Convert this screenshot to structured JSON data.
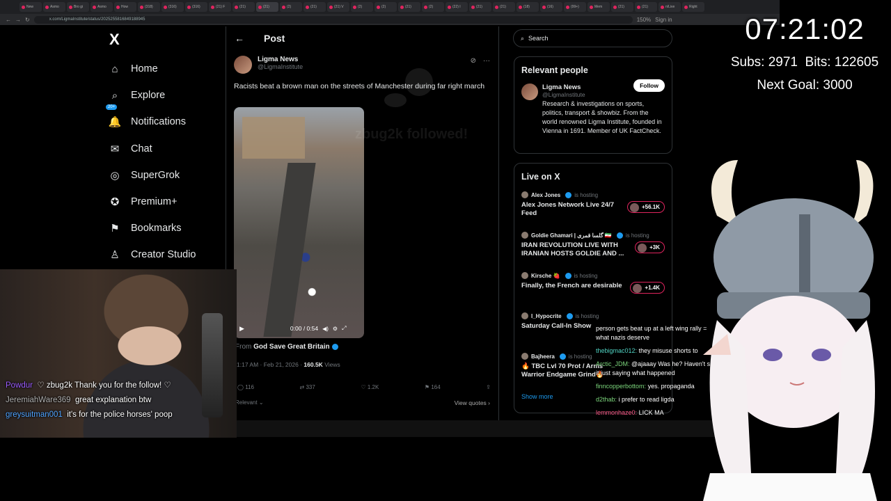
{
  "browser": {
    "tabs": [
      "New",
      "Asmo",
      "Bro gi",
      "Asmo",
      "How",
      "(318)",
      "(316)",
      "(316)",
      "(21) F",
      "(21)",
      "(21)",
      "(2)",
      "(21)",
      "(21) V",
      "(2)",
      "(2)",
      "(21)",
      "(2)",
      "(22) I",
      "(21)",
      "(21)",
      "(18)",
      "(16)",
      "(99+)",
      "Mem",
      "(21)",
      "(21)",
      "n/Live",
      "Right"
    ],
    "active_tab_index": 10,
    "url": "x.com/LigmaInstitute/status/2025255816849188945",
    "zoom": "150%",
    "sign_in": "Sign in"
  },
  "sidebar": {
    "logo": "X",
    "notifications_badge": "20+",
    "items": [
      {
        "label": "Home",
        "icon": "⌂"
      },
      {
        "label": "Explore",
        "icon": "⌕"
      },
      {
        "label": "Notifications",
        "icon": "🔔"
      },
      {
        "label": "Chat",
        "icon": "✉"
      },
      {
        "label": "SuperGrok",
        "icon": "◎"
      },
      {
        "label": "Premium+",
        "icon": "✪"
      },
      {
        "label": "Bookmarks",
        "icon": "⚑"
      },
      {
        "label": "Creator Studio",
        "icon": "♙"
      }
    ]
  },
  "post": {
    "header_title": "Post",
    "author_name": "Ligma News",
    "author_handle": "@LigmaInstitute",
    "text": "Racists beat a brown man on the streets of Manchester during far right march",
    "video_time": "0:00 / 0:54",
    "from_label": "From",
    "from_account": "God Save Great Britain",
    "timestamp": "1:17 AM · Feb 21, 2026 ·",
    "views_count": "160.5K",
    "views_label": "Views",
    "replies": "116",
    "reposts": "337",
    "likes": "1.2K",
    "bookmarks": "164",
    "sort_label": "Relevant",
    "view_quotes": "View quotes",
    "ghost_followed": "zbug2k followed!"
  },
  "search": {
    "placeholder": "Search"
  },
  "relevant_people": {
    "title": "Relevant people",
    "name": "Ligma News",
    "handle": "@LigmaInstitute",
    "follow_label": "Follow",
    "bio": "Research & investigations on sports, politics, transport & showbiz. From the world renowned Ligma Institute, founded in Vienna in 1691. Member of UK FactCheck."
  },
  "live_on_x": {
    "title": "Live on X",
    "hosting_label": "is hosting",
    "show_more": "Show more",
    "items": [
      {
        "host": "Alex Jones",
        "title": "Alex Jones Network Live 24/7 Feed",
        "count": "+56.1K"
      },
      {
        "host": "Goldie Ghamari | گلسا قمری 🇮🇷",
        "title": "IRAN REVOLUTION LIVE WITH IRANIAN HOSTS GOLDIE AND ...",
        "count": "+3K"
      },
      {
        "host": "Kirsche 🍓",
        "title": "Finally, the French are desirable",
        "count": "+1.4K"
      },
      {
        "host": "I_Hypocrite",
        "title": "Saturday Call-In Show",
        "count": ""
      },
      {
        "host": "Bajheera",
        "title": "🔥 TBC Lvl 70 Prot / Arms Warrior Endgame Grind🔥",
        "count": ""
      }
    ]
  },
  "stream_overlay": {
    "clock": "07:21:02",
    "subs": "Subs: 2971",
    "bits": "Bits: 122605",
    "next_goal": "Next Goal: 3000"
  },
  "chat_left": [
    {
      "user": "Powdur",
      "msg": "♡ zbug2k Thank you for the follow! ♡",
      "color": "#9b5cff"
    },
    {
      "user": "JeremiahWare369",
      "msg": "great explanation btw",
      "color": "#b0b0b0"
    },
    {
      "user": "greysuitman001",
      "msg": "it's for the police horses' poop",
      "color": "#4fa3ff"
    }
  ],
  "chat_right": [
    {
      "user": "",
      "msg": "person gets beat up at a left wing rally = what nazis deserve",
      "color": "#ffffff"
    },
    {
      "user": "thebigmac012:",
      "msg": "they misuse shorts to",
      "color": "#52d6c6"
    },
    {
      "user": "Arctic_JDM:",
      "msg": "@ajaaay Was he? Haven't seen it just saying what happened",
      "color": "#7cd67c"
    },
    {
      "user": "finncopperbottom:",
      "msg": "yes. propaganda",
      "color": "#7cd67c"
    },
    {
      "user": "d2thab:",
      "msg": "i prefer to read ligda",
      "color": "#7cd67c"
    },
    {
      "user": "lemmonhaze0:",
      "msg": "LICK MA",
      "color": "#ff5c8a"
    }
  ]
}
